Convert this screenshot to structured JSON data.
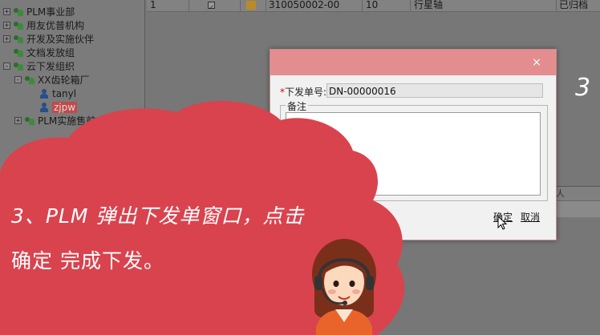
{
  "tree": {
    "items": [
      {
        "label": "PLM事业部",
        "icon": "group-icon",
        "expander": "+"
      },
      {
        "label": "用友优普机构",
        "icon": "group-icon",
        "expander": "+"
      },
      {
        "label": "开发及实施伙伴",
        "icon": "group-icon",
        "expander": "+"
      },
      {
        "label": "文档发放组",
        "icon": "group-icon",
        "expander": ""
      },
      {
        "label": "云下发组织",
        "icon": "group-icon",
        "expander": "-"
      },
      {
        "label": "XX齿轮箱厂",
        "icon": "group-icon",
        "expander": "-"
      },
      {
        "label": "tanyl",
        "icon": "user-icon",
        "expander": ""
      },
      {
        "label": "zjpw",
        "icon": "user-icon",
        "expander": ""
      },
      {
        "label": "PLM实施售前",
        "icon": "group-icon",
        "expander": "+"
      }
    ]
  },
  "grid": {
    "row": {
      "index": "1",
      "checked": "✓",
      "code": "310050002-00",
      "qty": "10",
      "name": "行星轴",
      "status": "已归档"
    }
  },
  "lower_panel": {
    "header": "人"
  },
  "step_number": "3",
  "dialog": {
    "required_mark": "*",
    "doc_label": "下发单号:",
    "doc_value": "DN-00000016",
    "memo_legend": "备注",
    "close_glyph": "×",
    "ok_label": "确定",
    "cancel_label": "取消"
  },
  "caption": {
    "line1": "3、PLM 弹出下发单窗口，点击",
    "line2": "确定 完成下发。"
  },
  "colors": {
    "cloud": "#d9434e",
    "dialog_title": "#e48d8f",
    "background": "#6f6f6f"
  }
}
